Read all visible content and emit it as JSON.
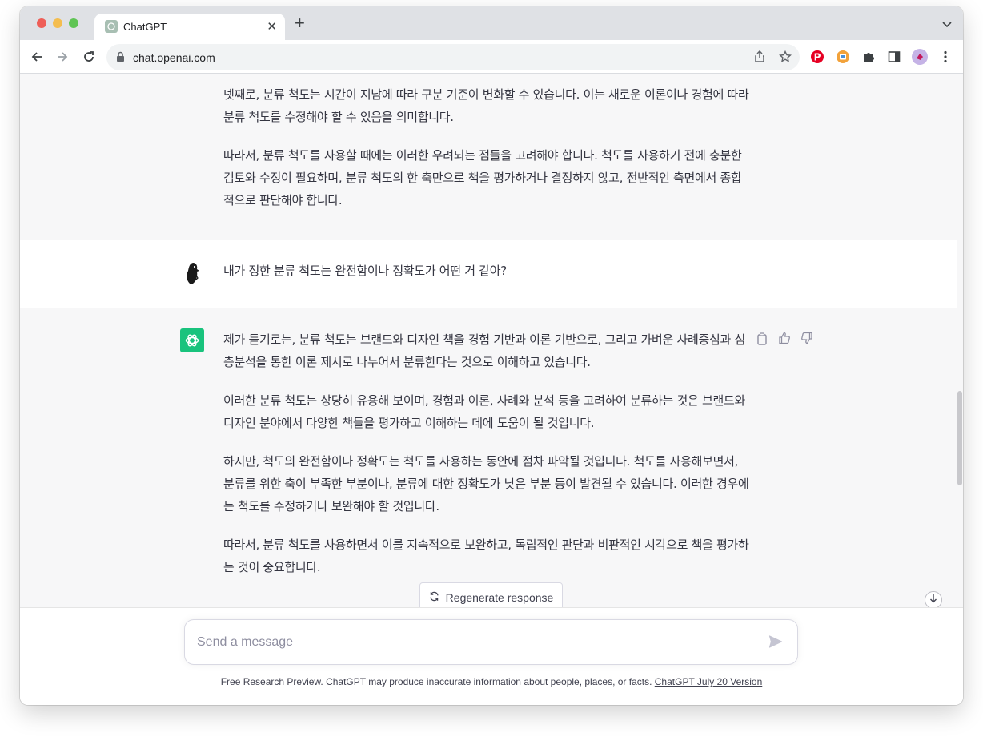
{
  "browser": {
    "tab_title": "ChatGPT",
    "url": "chat.openai.com"
  },
  "conversation": {
    "prev_assistant": [
      "넷째로, 분류 척도는 시간이 지남에 따라 구분 기준이 변화할 수 있습니다. 이는 새로운 이론이나 경험에 따라 분류 척도를 수정해야 할 수 있음을 의미합니다.",
      "따라서, 분류 척도를 사용할 때에는 이러한 우려되는 점들을 고려해야 합니다. 척도를 사용하기 전에 충분한 검토와 수정이 필요하며, 분류 척도의 한 축만으로 책을 평가하거나 결정하지 않고, 전반적인 측면에서 종합적으로 판단해야 합니다."
    ],
    "user_message": "내가 정한 분류 척도는 완전함이나 정확도가 어떤 거 같아?",
    "assistant": [
      "제가 듣기로는, 분류 척도는 브랜드와 디자인 책을 경험 기반과 이론 기반으로, 그리고 가벼운 사례중심과 심층분석을 통한 이론 제시로 나누어서 분류한다는 것으로 이해하고 있습니다.",
      "이러한 분류 척도는 상당히 유용해 보이며, 경험과 이론, 사례와 분석 등을 고려하여 분류하는 것은 브랜드와 디자인 분야에서 다양한 책들을 평가하고 이해하는 데에 도움이 될 것입니다.",
      "하지만, 척도의 완전함이나 정확도는 척도를 사용하는 동안에 점차 파악될 것입니다. 척도를 사용해보면서, 분류를 위한 축이 부족한 부분이나, 분류에 대한 정확도가 낮은 부분 등이 발견될 수 있습니다. 이러한 경우에는 척도를 수정하거나 보완해야 할 것입니다.",
      "따라서, 분류 척도를 사용하면서 이를 지속적으로 보완하고, 독립적인 판단과 비판적인 시각으로 책을 평가하는 것이 중요합니다."
    ]
  },
  "regenerate_label": "Regenerate response",
  "input": {
    "placeholder": "Send a message"
  },
  "footer": {
    "text": "Free Research Preview. ChatGPT may produce inaccurate information about people, places, or facts.",
    "link": "ChatGPT July 20 Version"
  },
  "colors": {
    "accent": "#19c37d",
    "assistant_bg": "#f7f7f8",
    "text": "#343541"
  },
  "icons": [
    "openai-logo-icon",
    "copy-icon",
    "thumbs-up-icon",
    "thumbs-down-icon",
    "refresh-icon",
    "arrow-down-icon",
    "send-icon",
    "lock-icon",
    "share-icon",
    "star-icon",
    "pinterest-icon",
    "extension-icon",
    "puzzle-icon",
    "sidebar-icon",
    "profile-icon",
    "more-vert-icon"
  ]
}
